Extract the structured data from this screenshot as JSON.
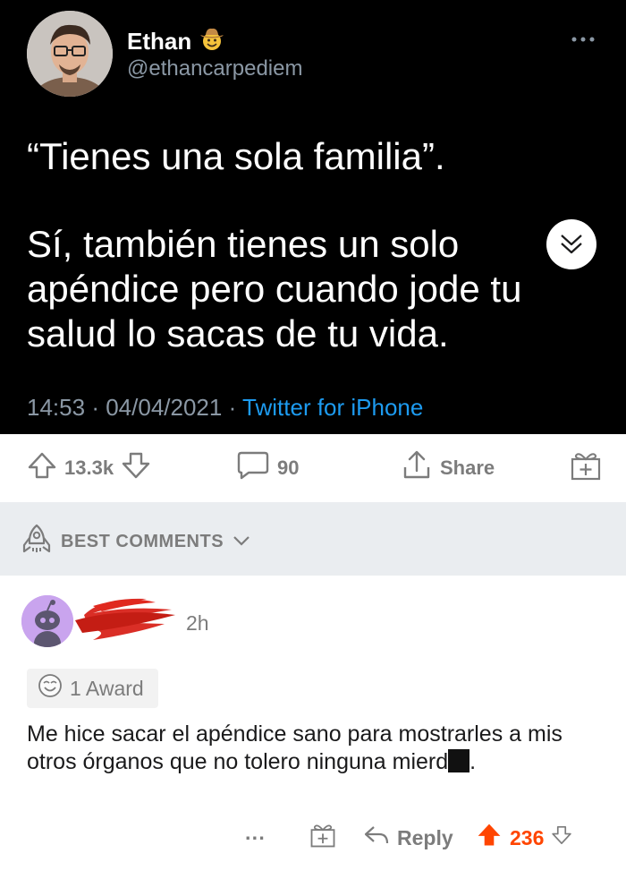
{
  "tweet": {
    "author_name": "Ethan",
    "author_emoji": "cowboy-emoji",
    "handle": "@ethancarpediem",
    "more_icon": "more-horizontal-icon",
    "paragraph_1": "“Tienes una sola familia”.",
    "paragraph_2": "Sí, también tienes un solo\napéndice pero cuando jode tu\nsalud lo sacas de tu vida.",
    "time": "14:53",
    "date": "04/04/2021",
    "separator": "·",
    "source": "Twitter for iPhone",
    "source_color": "#1d9bf0"
  },
  "post_actions": {
    "upvote_icon": "arrow-up-icon",
    "score": "13.3k",
    "downvote_icon": "arrow-down-icon",
    "comment_icon": "comment-bubble-icon",
    "comments_count": "90",
    "share_icon": "share-icon",
    "share_label": "Share",
    "award_icon": "gift-icon"
  },
  "sort": {
    "icon": "rocket-icon",
    "label": "BEST COMMENTS",
    "chevron_icon": "chevron-down-icon"
  },
  "comment": {
    "avatar_icon": "snoo-avatar-icon",
    "username_redacted": true,
    "time": "2h",
    "award_icon": "award-emoji-icon",
    "award_label": "1 Award",
    "text_before": "Me hice sacar el apéndice sano para mostrarles a mis otros órganos que no tolero ninguna mierd",
    "text_after": ".",
    "more_label": "···",
    "gift_icon": "gift-icon",
    "reply_icon": "reply-arrow-icon",
    "reply_label": "Reply",
    "upvote_icon": "arrow-up-filled-icon",
    "score": "236",
    "score_color": "#ff4500",
    "downvote_icon": "arrow-down-icon",
    "collapse_icon": "double-chevron-down-icon"
  }
}
